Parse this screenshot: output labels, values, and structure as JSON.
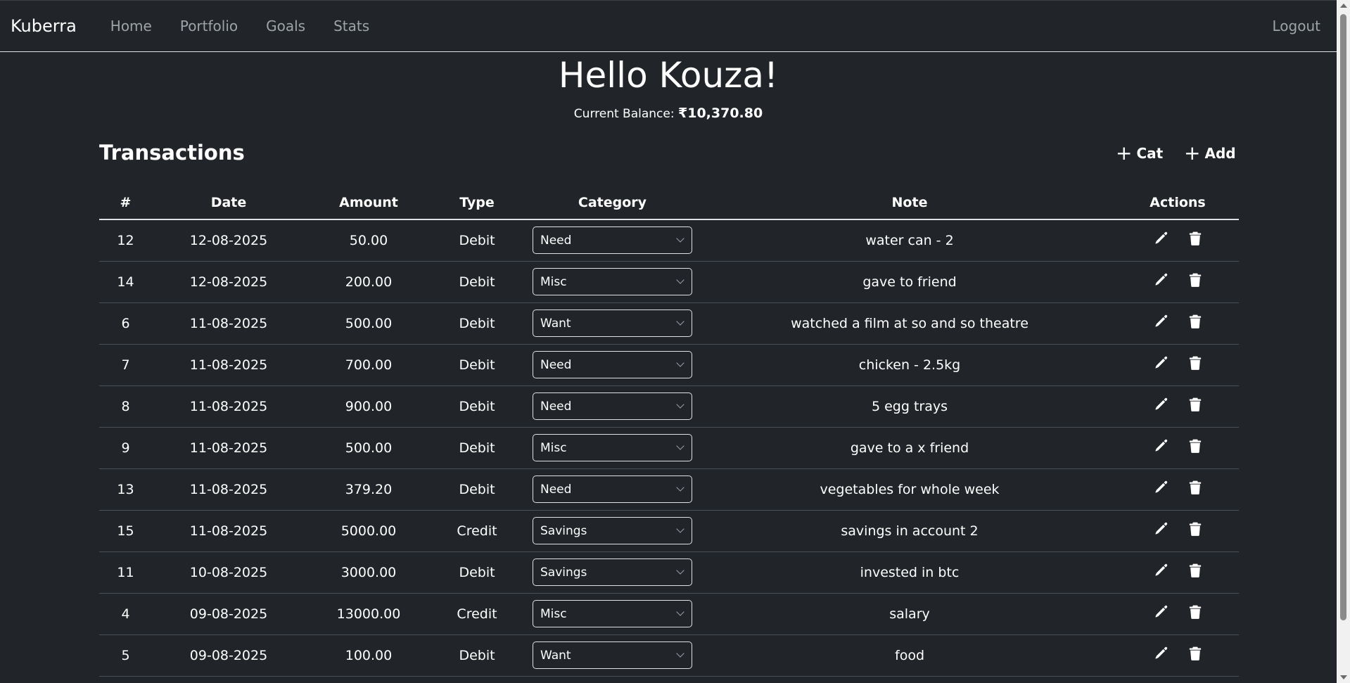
{
  "nav": {
    "brand": "Kuberra",
    "links": [
      "Home",
      "Portfolio",
      "Goals",
      "Stats"
    ],
    "logout": "Logout"
  },
  "header": {
    "greeting": "Hello Kouza!",
    "balance_label": "Current Balance:",
    "balance_value": "₹10,370.80"
  },
  "transactions": {
    "title": "Transactions",
    "add_category_label": "Cat",
    "add_label": "Add",
    "columns": [
      "#",
      "Date",
      "Amount",
      "Type",
      "Category",
      "Note",
      "Actions"
    ],
    "rows": [
      {
        "id": "12",
        "date": "12-08-2025",
        "amount": "50.00",
        "type": "Debit",
        "category": "Need",
        "note": "water can - 2"
      },
      {
        "id": "14",
        "date": "12-08-2025",
        "amount": "200.00",
        "type": "Debit",
        "category": "Misc",
        "note": "gave to friend"
      },
      {
        "id": "6",
        "date": "11-08-2025",
        "amount": "500.00",
        "type": "Debit",
        "category": "Want",
        "note": "watched a film at so and so theatre"
      },
      {
        "id": "7",
        "date": "11-08-2025",
        "amount": "700.00",
        "type": "Debit",
        "category": "Need",
        "note": "chicken - 2.5kg"
      },
      {
        "id": "8",
        "date": "11-08-2025",
        "amount": "900.00",
        "type": "Debit",
        "category": "Need",
        "note": "5 egg trays"
      },
      {
        "id": "9",
        "date": "11-08-2025",
        "amount": "500.00",
        "type": "Debit",
        "category": "Misc",
        "note": "gave to a x friend"
      },
      {
        "id": "13",
        "date": "11-08-2025",
        "amount": "379.20",
        "type": "Debit",
        "category": "Need",
        "note": "vegetables for whole week"
      },
      {
        "id": "15",
        "date": "11-08-2025",
        "amount": "5000.00",
        "type": "Credit",
        "category": "Savings",
        "note": "savings in account 2"
      },
      {
        "id": "11",
        "date": "10-08-2025",
        "amount": "3000.00",
        "type": "Debit",
        "category": "Savings",
        "note": "invested in btc"
      },
      {
        "id": "4",
        "date": "09-08-2025",
        "amount": "13000.00",
        "type": "Credit",
        "category": "Misc",
        "note": "salary"
      },
      {
        "id": "5",
        "date": "09-08-2025",
        "amount": "100.00",
        "type": "Debit",
        "category": "Want",
        "note": "food"
      }
    ]
  },
  "icons": {
    "edit": "pencil-icon",
    "delete": "trash-icon",
    "add": "plus-icon",
    "dropdown": "chevron-down-icon"
  },
  "colors": {
    "background": "#212529",
    "text": "#ffffff",
    "muted": "#9ea3a8",
    "border": "#dee2e6",
    "row_border": "#495057"
  }
}
